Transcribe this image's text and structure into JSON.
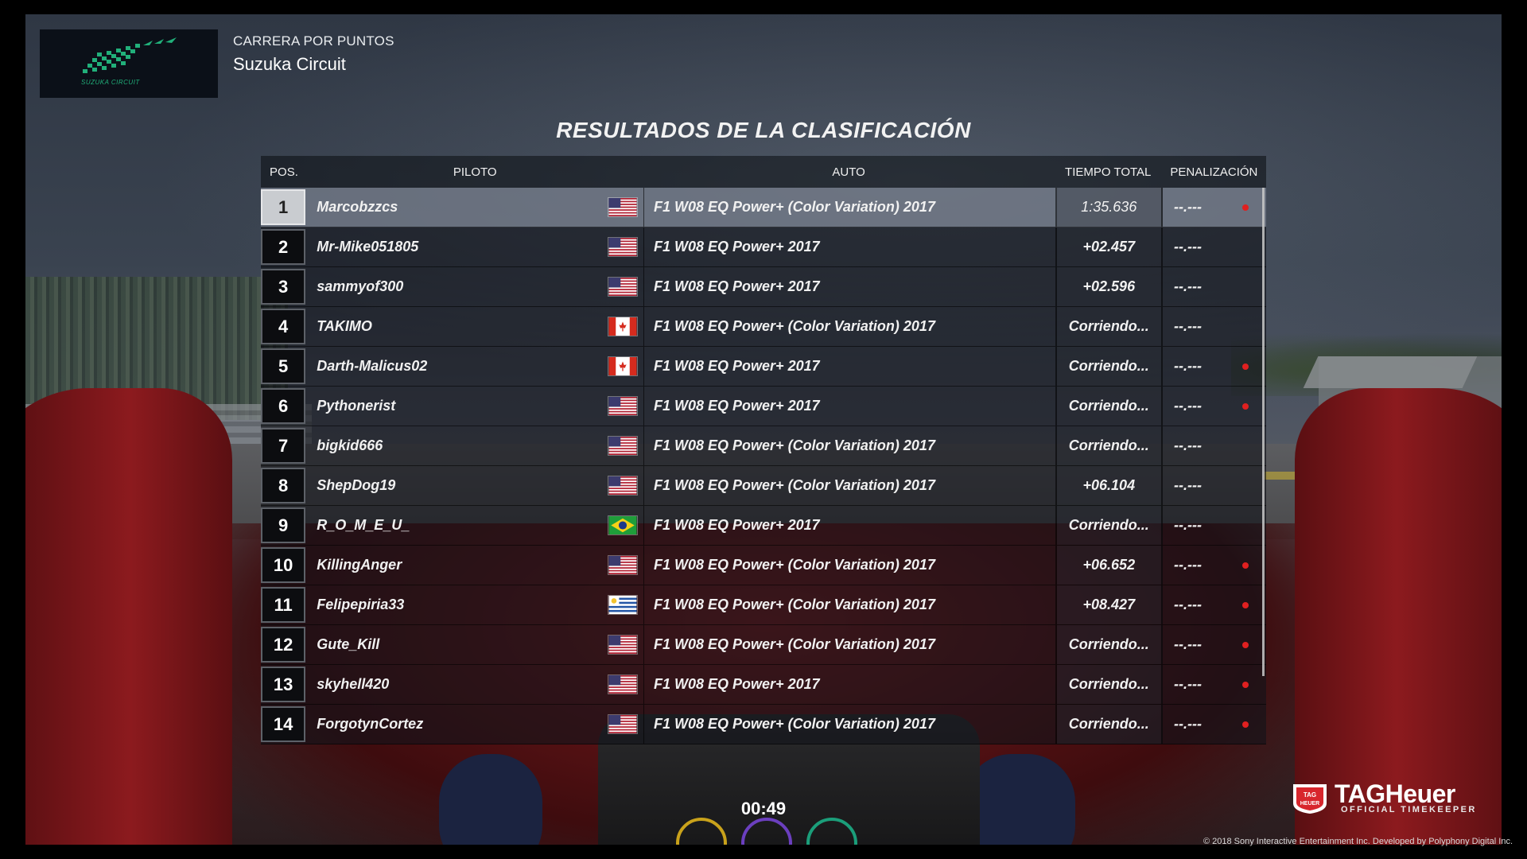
{
  "header": {
    "event_type": "CARRERA POR PUNTOS",
    "track_name": "Suzuka Circuit",
    "logo_text": "SUZUKA CIRCUIT"
  },
  "results_title": "RESULTADOS DE LA CLASIFICACIÓN",
  "table": {
    "headers": {
      "pos": "POS.",
      "pilot": "PILOTO",
      "car": "AUTO",
      "total_time": "TIEMPO TOTAL",
      "penalty": "PENALIZACIÓN"
    },
    "rows": [
      {
        "pos": "1",
        "pilot": "Marcobzzcs",
        "flag": "usa",
        "car": "F1 W08 EQ Power+ (Color Variation) 2017",
        "time": "1:35.636",
        "penalty": "--.---",
        "dot": true,
        "selected": true
      },
      {
        "pos": "2",
        "pilot": "Mr-Mike051805",
        "flag": "usa",
        "car": "F1 W08 EQ Power+ 2017",
        "time": "+02.457",
        "penalty": "--.---",
        "dot": false
      },
      {
        "pos": "3",
        "pilot": "sammyof300",
        "flag": "usa",
        "car": "F1 W08 EQ Power+ 2017",
        "time": "+02.596",
        "penalty": "--.---",
        "dot": false
      },
      {
        "pos": "4",
        "pilot": "TAKIMO",
        "flag": "canada",
        "car": "F1 W08 EQ Power+ (Color Variation) 2017",
        "time": "Corriendo...",
        "penalty": "--.---",
        "dot": false
      },
      {
        "pos": "5",
        "pilot": "Darth-Malicus02",
        "flag": "canada",
        "car": "F1 W08 EQ Power+ 2017",
        "time": "Corriendo...",
        "penalty": "--.---",
        "dot": true
      },
      {
        "pos": "6",
        "pilot": "Pythonerist",
        "flag": "usa",
        "car": "F1 W08 EQ Power+ 2017",
        "time": "Corriendo...",
        "penalty": "--.---",
        "dot": true
      },
      {
        "pos": "7",
        "pilot": "bigkid666",
        "flag": "usa",
        "car": "F1 W08 EQ Power+ (Color Variation) 2017",
        "time": "Corriendo...",
        "penalty": "--.---",
        "dot": false
      },
      {
        "pos": "8",
        "pilot": "ShepDog19",
        "flag": "usa",
        "car": "F1 W08 EQ Power+ (Color Variation) 2017",
        "time": "+06.104",
        "penalty": "--.---",
        "dot": false
      },
      {
        "pos": "9",
        "pilot": "R_O_M_E_U_",
        "flag": "brazil",
        "car": "F1 W08 EQ Power+ 2017",
        "time": "Corriendo...",
        "penalty": "--.---",
        "dot": false
      },
      {
        "pos": "10",
        "pilot": "KillingAnger",
        "flag": "usa",
        "car": "F1 W08 EQ Power+ (Color Variation) 2017",
        "time": "+06.652",
        "penalty": "--.---",
        "dot": true
      },
      {
        "pos": "11",
        "pilot": "Felipepiria33",
        "flag": "uruguay",
        "car": "F1 W08 EQ Power+ (Color Variation) 2017",
        "time": "+08.427",
        "penalty": "--.---",
        "dot": true
      },
      {
        "pos": "12",
        "pilot": "Gute_Kill",
        "flag": "usa",
        "car": "F1 W08 EQ Power+ (Color Variation) 2017",
        "time": "Corriendo...",
        "penalty": "--.---",
        "dot": true
      },
      {
        "pos": "13",
        "pilot": "skyhell420",
        "flag": "usa",
        "car": "F1 W08 EQ Power+ 2017",
        "time": "Corriendo...",
        "penalty": "--.---",
        "dot": true
      },
      {
        "pos": "14",
        "pilot": "ForgotynCortez",
        "flag": "usa",
        "car": "F1 W08 EQ Power+ (Color Variation) 2017",
        "time": "Corriendo...",
        "penalty": "--.---",
        "dot": true
      }
    ]
  },
  "footer": {
    "timer": "00:49",
    "sponsor_brand": "TAGHeuer",
    "sponsor_sub": "OFFICIAL TIMEKEEPER",
    "sponsor_badge": "TAG HEUER",
    "copyright": "© 2018 Sony Interactive Entertainment Inc. Developed by Polyphony Digital Inc."
  },
  "colors": {
    "selected_row": "#7a8290",
    "penalty_dot": "#e02020",
    "logo_green": "#21b07a",
    "tag_red": "#d8262d"
  }
}
